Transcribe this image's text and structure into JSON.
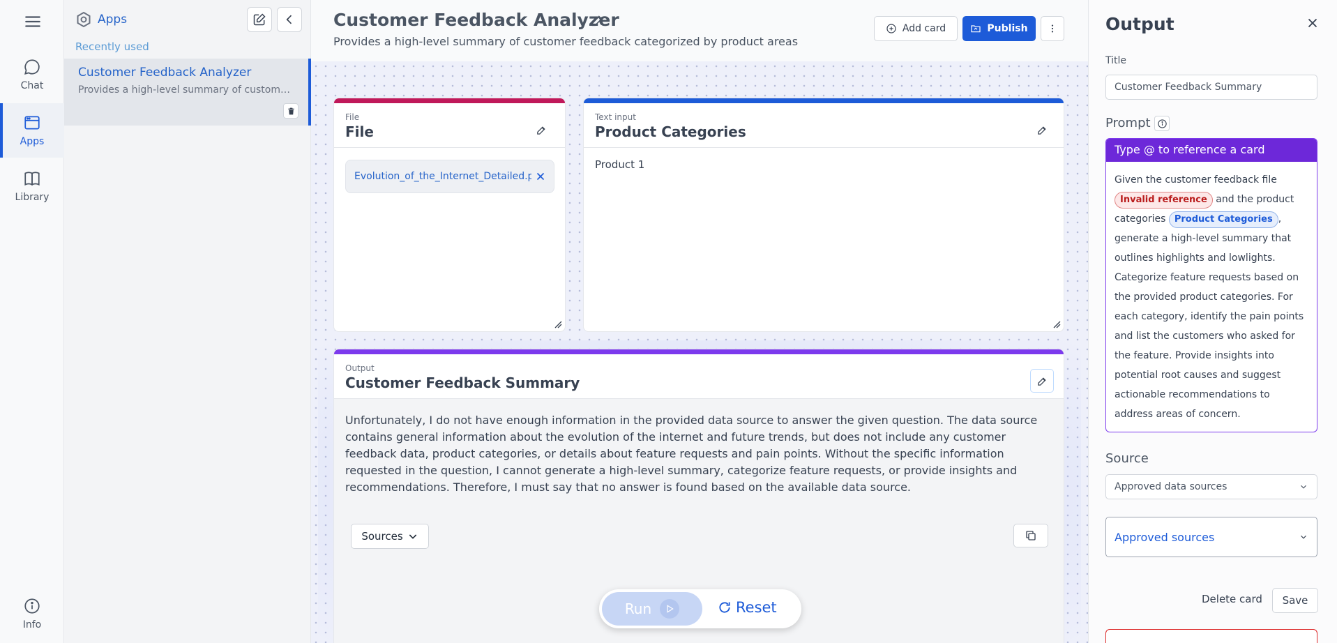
{
  "rail": {
    "items": [
      {
        "label": "Chat",
        "icon": "chat-bubble-icon"
      },
      {
        "label": "Apps",
        "icon": "browser-window-icon"
      },
      {
        "label": "Library",
        "icon": "book-icon"
      }
    ],
    "info_label": "Info"
  },
  "apps_panel": {
    "title": "Apps",
    "recent_label": "Recently used",
    "recent": [
      {
        "title": "Customer Feedback Analyzer",
        "description": "Provides a high-level summary of customer feedback categorized by product areas"
      }
    ]
  },
  "header": {
    "title": "Customer Feedback Analyzer",
    "subtitle": "Provides a high-level summary of customer feedback categorized by product areas",
    "add_card_label": "Add card",
    "publish_label": "Publish"
  },
  "cards": {
    "file": {
      "kind": "File",
      "title": "File",
      "file_name": "Evolution_of_the_Internet_Detailed.pdf",
      "accent": "#c0185a"
    },
    "text": {
      "kind": "Text input",
      "title": "Product Categories",
      "value": "Product 1",
      "accent": "#1d5bd8"
    },
    "output": {
      "kind": "Output",
      "title": "Customer Feedback Summary",
      "accent": "#7c3aed",
      "body": "Unfortunately, I do not have enough information in the provided data source to answer the given question. The data source contains general information about the evolution of the internet and future trends, but does not include any customer feedback data, product categories, or details about feature requests and pain points. Without the specific information requested in the question, I cannot generate a high-level summary, categorize feature requests, or provide insights and recommendations. Therefore, I must say that no answer is found based on the available data source.",
      "sources_label": "Sources"
    }
  },
  "run_bar": {
    "run_label": "Run",
    "reset_label": "Reset"
  },
  "side_panel": {
    "title": "Output",
    "title_label": "Title",
    "title_value": "Customer Feedback Summary",
    "prompt_label": "Prompt",
    "prompt_hint": "Type @ to reference a card",
    "prompt_parts": {
      "p1": "Given the customer feedback file ",
      "ref_invalid": "Invalid reference",
      "p2": " and the product categories ",
      "ref_valid": "Product Categories",
      "p3": ", generate a high-level summary that outlines highlights and lowlights. Categorize feature requests based on the provided product categories. For each category, identify the pain points and list the customers who asked for the feature. Provide insights into potential root causes and suggest actionable recommendations to address areas of concern."
    },
    "source_label": "Source",
    "source_value": "Approved data sources",
    "approved_label": "Approved sources",
    "delete_label": "Delete card",
    "save_label": "Save"
  },
  "colors": {
    "primary": "#1d5bd8",
    "prompt_purple": "#6d28d9",
    "invalid_red": "#b91c1c"
  }
}
